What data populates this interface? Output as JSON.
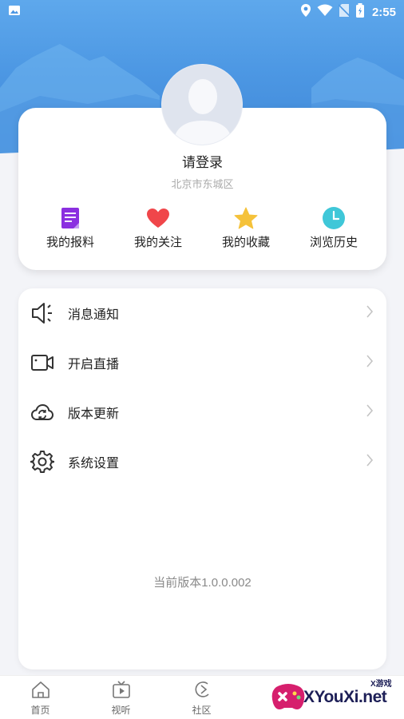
{
  "status_bar": {
    "time": "2:55",
    "icons": [
      "image-icon",
      "location-icon",
      "wifi-icon",
      "no-sim-icon",
      "battery-icon"
    ]
  },
  "profile": {
    "login_prompt": "请登录",
    "location": "北京市东城区",
    "quick_actions": [
      {
        "label": "我的报料",
        "icon": "report-doc-icon",
        "color": "#8b2fe0"
      },
      {
        "label": "我的关注",
        "icon": "heart-icon",
        "color": "#f0464a"
      },
      {
        "label": "我的收藏",
        "icon": "star-icon",
        "color": "#f5c23a"
      },
      {
        "label": "浏览历史",
        "icon": "clock-icon",
        "color": "#3fc7d8"
      }
    ]
  },
  "menu": {
    "items": [
      {
        "label": "消息通知",
        "icon": "speaker-icon"
      },
      {
        "label": "开启直播",
        "icon": "video-camera-icon"
      },
      {
        "label": "版本更新",
        "icon": "cloud-refresh-icon"
      },
      {
        "label": "系统设置",
        "icon": "gear-icon"
      }
    ],
    "version": "当前版本1.0.0.002"
  },
  "tab_bar": {
    "tabs": [
      {
        "label": "首页",
        "icon": "home-icon"
      },
      {
        "label": "视听",
        "icon": "tv-play-icon"
      },
      {
        "label": "社区",
        "icon": "community-icon"
      }
    ]
  },
  "watermark": {
    "brand": "XYouXi.net",
    "tag": "X游戏"
  },
  "colors": {
    "header_blue": "#4c97e3",
    "background": "#f3f4f8"
  }
}
